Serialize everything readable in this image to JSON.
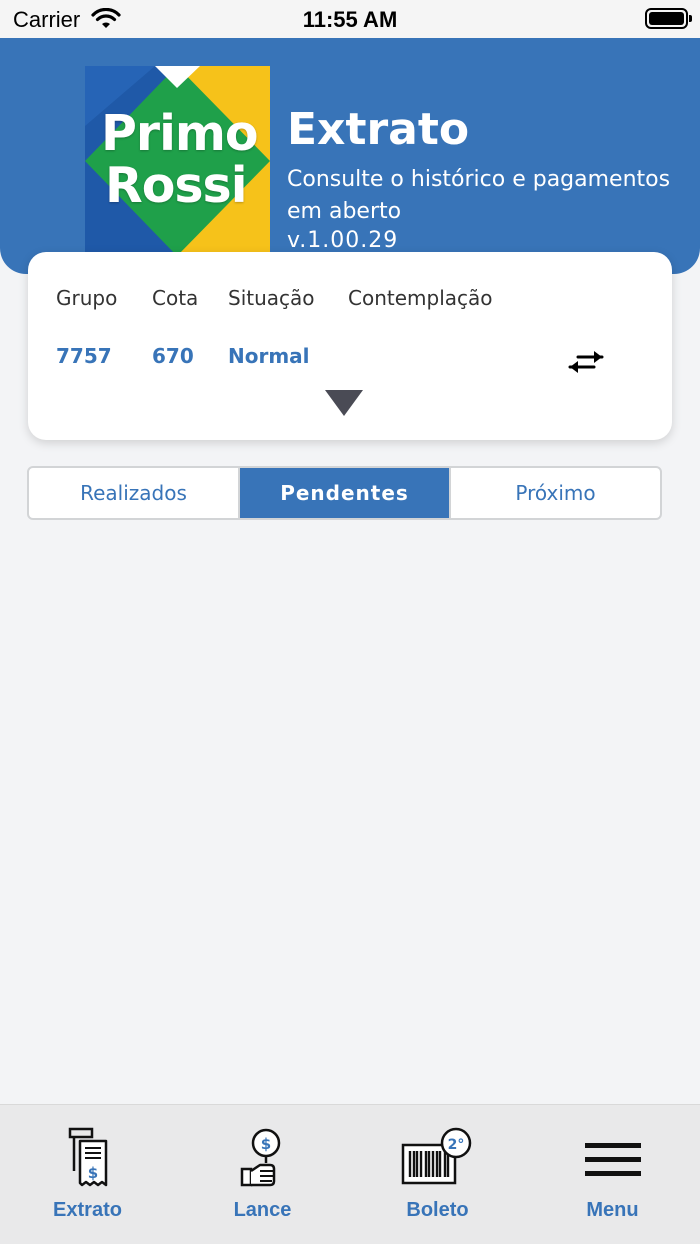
{
  "status_bar": {
    "carrier": "Carrier",
    "time": "11:55 AM"
  },
  "header": {
    "logo_line1": "Primo",
    "logo_line2": "Rossi",
    "title": "Extrato",
    "subtitle": "Consulte o histórico e pagamentos em aberto",
    "version": "v.1.00.29"
  },
  "card": {
    "labels": [
      "Grupo",
      "Cota",
      "Situação",
      "Contemplação"
    ],
    "values": [
      "7757",
      "670",
      "Normal",
      ""
    ]
  },
  "segments": [
    "Realizados",
    "Pendentes",
    "Próximo"
  ],
  "selected_segment": "Pendentes",
  "tabbar": [
    "Extrato",
    "Lance",
    "Boleto",
    "Menu"
  ],
  "colors": {
    "accent": "#3874b8",
    "background": "#f3f4f6",
    "logo_green": "#1fa04a",
    "logo_yellow": "#f6c21a"
  }
}
